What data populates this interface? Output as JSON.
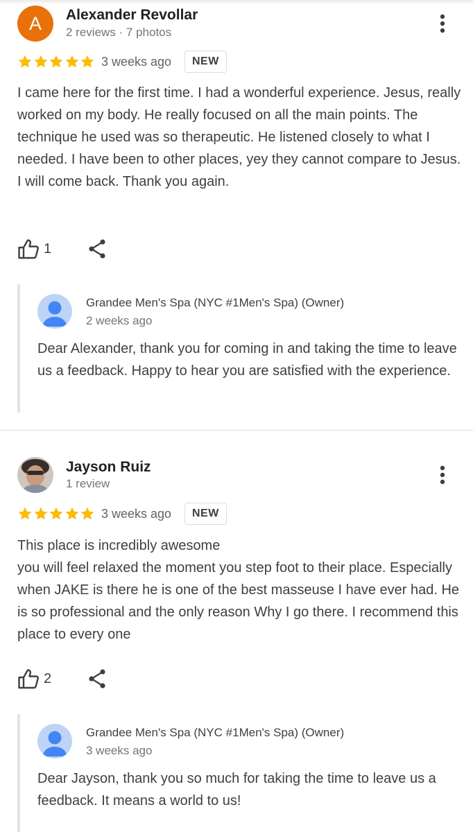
{
  "reviews": [
    {
      "author": "Alexander Revollar",
      "avatar_letter": "A",
      "meta": "2 reviews · 7 photos",
      "rating": 5,
      "time": "3 weeks ago",
      "badge": "NEW",
      "text": "I came here for the first time. I had a wonderful experience. Jesus, really worked on my body. He really focused on all the main points. The technique he used was so therapeutic. He listened closely to what I needed. I have been to other places, yey they cannot compare to Jesus. I will come back. Thank you again.",
      "likes": "1",
      "reply": {
        "owner": "Grandee Men's Spa (NYC #1Men's Spa) (Owner)",
        "time": "2 weeks ago",
        "text": "Dear Alexander, thank you for coming in and taking the time to leave us a feedback. Happy to hear you are satisfied with the experience."
      }
    },
    {
      "author": "Jayson Ruiz",
      "meta": "1 review",
      "rating": 5,
      "time": "3 weeks ago",
      "badge": "NEW",
      "text": "This place is incredibly awesome\nyou will feel relaxed the moment you step foot to their place. Especially when JAKE is there he is one of the best masseuse I have ever had. He is so professional and the only reason Why I go there. I recommend this place to every one",
      "likes": "2",
      "reply": {
        "owner": "Grandee Men's Spa (NYC #1Men's Spa) (Owner)",
        "time": "3 weeks ago",
        "text": "Dear Jayson, thank you so much for taking the time to leave us a feedback. It means a world to us!"
      }
    }
  ],
  "colors": {
    "star": "#fbbc04",
    "avatar_orange": "#e8710a",
    "owner_avatar_bg": "#bdd4f7",
    "owner_avatar_fg": "#4285f4"
  },
  "icons": {
    "more": "more-vert-icon",
    "like": "thumb-up-icon",
    "share": "share-icon",
    "star": "star-icon"
  }
}
